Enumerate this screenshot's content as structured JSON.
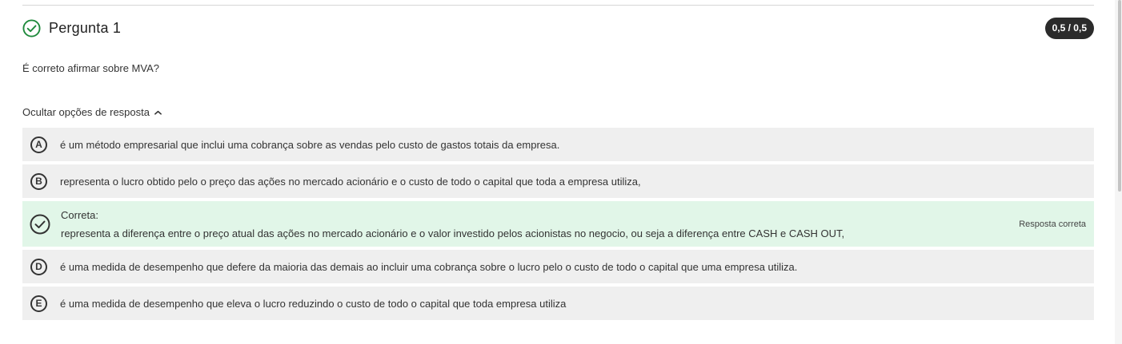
{
  "question": {
    "title": "Pergunta 1",
    "score": "0,5 / 0,5",
    "status_icon": "check-circle-icon",
    "text": "É correto afirmar sobre MVA?"
  },
  "options_toggle": {
    "label": "Ocultar opções de resposta",
    "icon": "chevron-up-icon"
  },
  "options": [
    {
      "letter": "A",
      "text": "é um método empresarial que inclui uma cobrança sobre as vendas pelo custo de gastos totais da empresa."
    },
    {
      "letter": "B",
      "text": "representa o lucro obtido pelo o preço das ações no mercado acionário e o custo de todo o capital que toda a empresa utiliza,"
    },
    {
      "label": "Correta:",
      "text": "representa a diferença entre o preço atual das ações no mercado acionário e o valor investido pelos acionistas no negocio, ou seja a diferença entre CASH e CASH OUT,",
      "note": "Resposta correta"
    },
    {
      "letter": "D",
      "text": "é uma medida de desempenho que defere da maioria das demais ao incluir uma cobrança sobre o lucro pelo o custo de todo o capital que uma empresa utiliza."
    },
    {
      "letter": "E",
      "text": "é uma medida de desempenho que eleva o lucro reduzindo o custo de todo o capital que toda empresa utiliza"
    }
  ],
  "colors": {
    "correct_green": "#1f8a3c",
    "correct_bg": "#e1f6e8",
    "option_bg": "#efefef",
    "badge_bg": "#2b2b2b"
  }
}
